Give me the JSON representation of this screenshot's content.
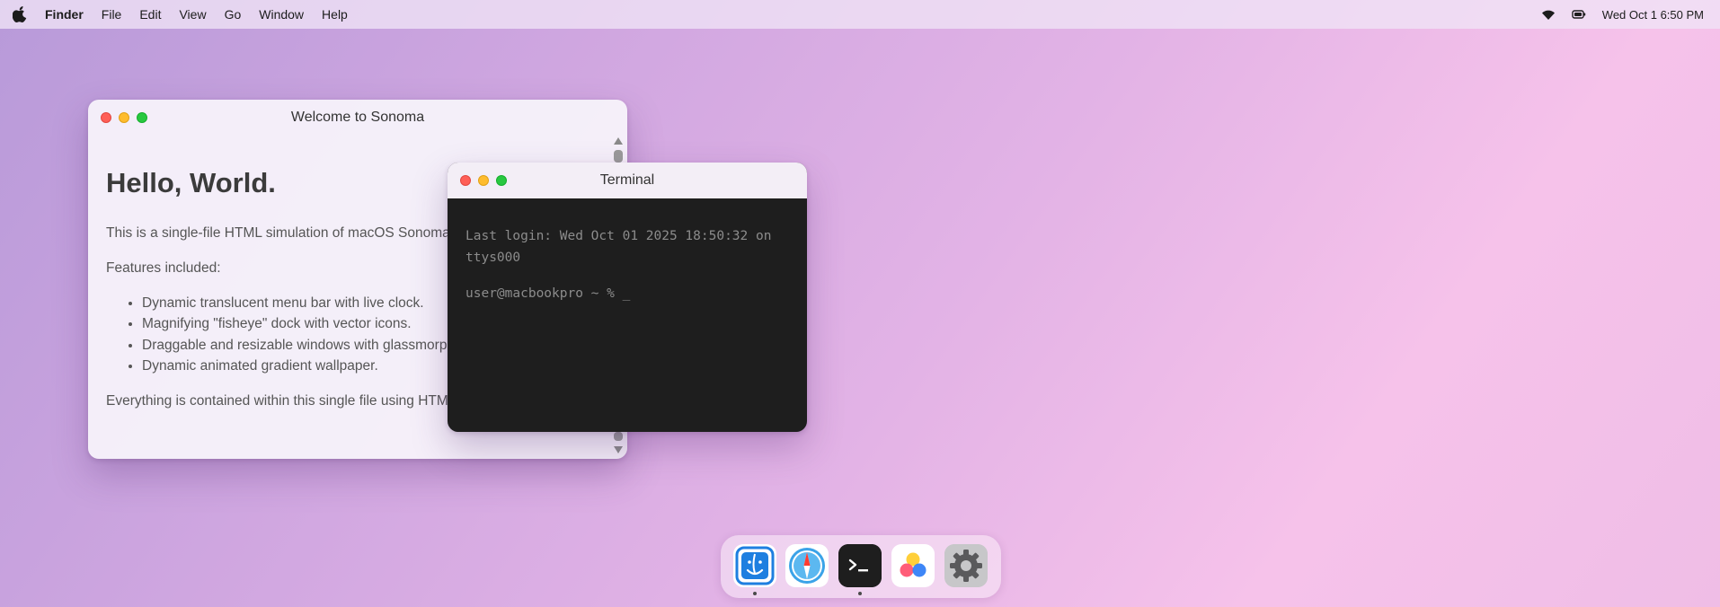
{
  "menubar": {
    "apple_icon": "apple-logo-icon",
    "app_name": "Finder",
    "items": [
      "File",
      "Edit",
      "View",
      "Go",
      "Window",
      "Help"
    ],
    "status": {
      "wifi_icon": "wifi-icon",
      "battery_icon": "battery-icon",
      "clock": "Wed Oct 1 6:50 PM"
    }
  },
  "welcome_window": {
    "title": "Welcome to Sonoma",
    "heading": "Hello, World.",
    "intro": "This is a single-file HTML simulation of macOS Sonoma.",
    "features_label": "Features included:",
    "features": [
      "Dynamic translucent menu bar with live clock.",
      "Magnifying \"fisheye\" dock with vector icons.",
      "Draggable and resizable windows with glassmorphism.",
      "Dynamic animated gradient wallpaper."
    ],
    "footer": "Everything is contained within this single file using HTML, CSS, and JavaScript."
  },
  "terminal_window": {
    "title": "Terminal",
    "last_login": "Last login: Wed Oct 01 2025 18:50:32 on ttys000",
    "prompt": "user@macbookpro ~ % _"
  },
  "dock": {
    "items": [
      {
        "icon": "finder-icon",
        "running": true
      },
      {
        "icon": "safari-compass-icon",
        "running": false
      },
      {
        "icon": "terminal-icon",
        "running": true
      },
      {
        "icon": "photos-icon",
        "running": false
      },
      {
        "icon": "settings-gear-icon",
        "running": false
      }
    ]
  },
  "colors": {
    "close": "#ff5f57",
    "minimize": "#febc2e",
    "maximize": "#28c840",
    "terminal_bg": "#1e1e1e",
    "finder_blue": "#1e7fe0"
  }
}
